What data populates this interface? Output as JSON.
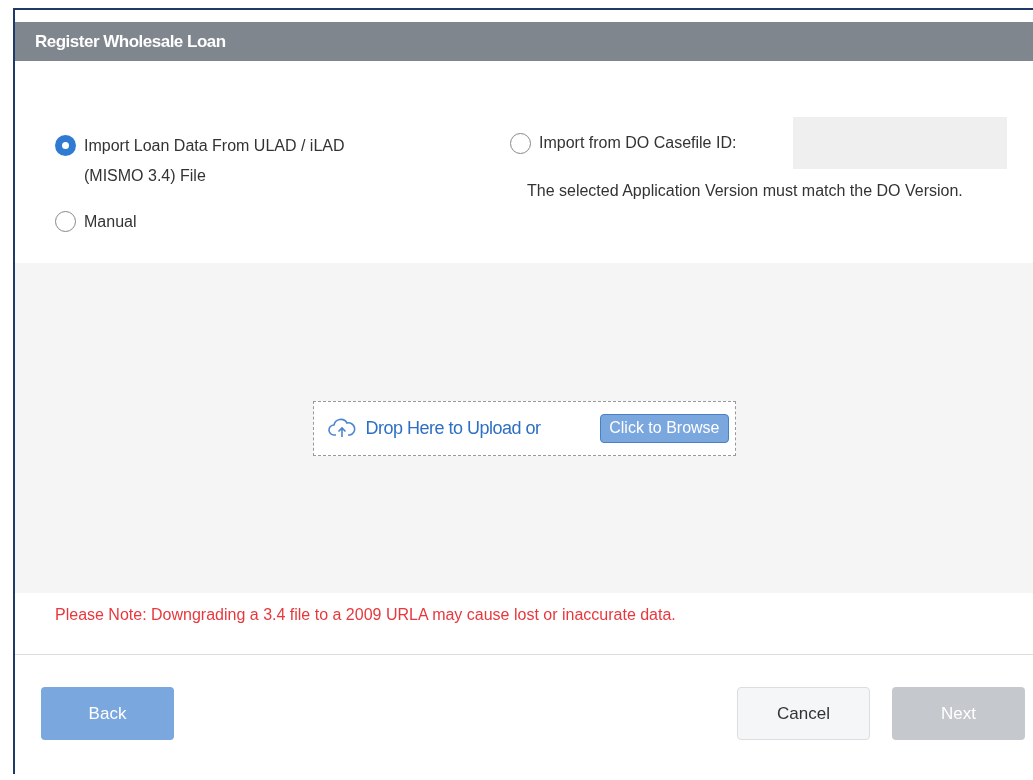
{
  "dialog": {
    "title": "Register Wholesale Loan"
  },
  "options": [
    {
      "kind": "radio",
      "label": "Import Loan Data From ULAD / iLAD (MISMO 3.4) File",
      "selected": true
    },
    {
      "kind": "radio",
      "label": "Manual",
      "selected": false
    },
    {
      "kind": "field",
      "label": "Import from DO Casefile ID:",
      "selected": false,
      "hint": "The selected Application Version must match the DO Version."
    }
  ],
  "upload": {
    "text": "Drop Here to Upload or",
    "button": "Click to Browse"
  },
  "note": "Please Note: Downgrading a 3.4 file to a 2009 URLA may cause lost or inaccurate data.",
  "buttons": [
    {
      "kind": "back",
      "label": "Back",
      "disabled": false
    },
    {
      "kind": "cancel",
      "label": "Cancel",
      "disabled": false
    },
    {
      "kind": "next",
      "label": "Next",
      "disabled": true
    }
  ]
}
